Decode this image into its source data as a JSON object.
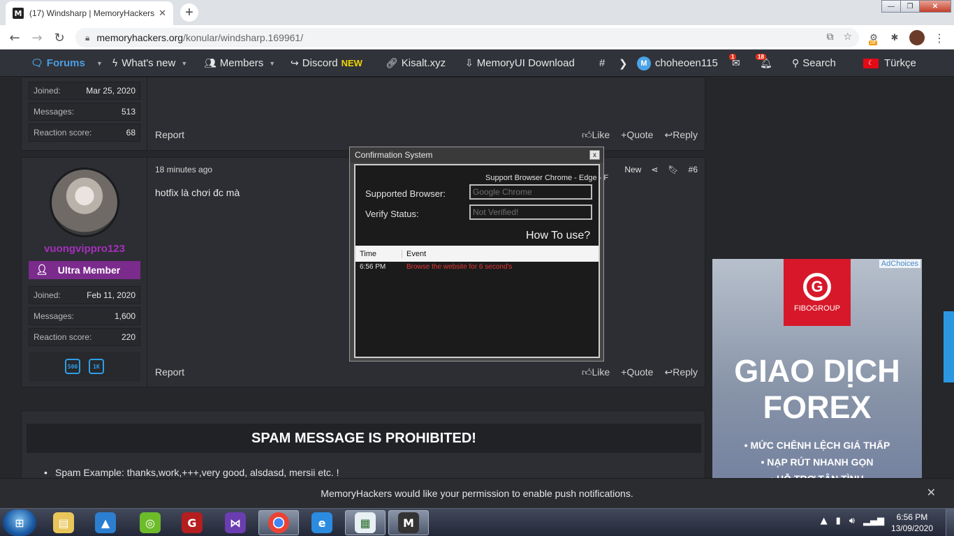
{
  "browser": {
    "tab_title": "(17) Windsharp | MemoryHackers",
    "tab_close": "✕",
    "new_tab": "+",
    "favicon": "M",
    "url_domain": "memoryhackers.org",
    "url_path": "/konular/windsharp.169961/",
    "ext_off": "off",
    "win_controls": {
      "minimize": "—",
      "maximize": "❐",
      "close": "✕"
    }
  },
  "nav": {
    "forums": "Forums",
    "whats_new": "What's new",
    "members": "Members",
    "discord": "Discord",
    "discord_badge": "NEW",
    "kisalt": "Kisalt.xyz",
    "memoryui": "MemoryUI Download",
    "hash": "#",
    "more": "❯",
    "username": "choheoen115",
    "inbox_count": "1",
    "alerts_count": "18",
    "search": "Search",
    "language": "Türkçe"
  },
  "post_top": {
    "stats": [
      {
        "key": "Joined:",
        "value": "Mar 25, 2020"
      },
      {
        "key": "Messages:",
        "value": "513"
      },
      {
        "key": "Reaction score:",
        "value": "68"
      }
    ],
    "report": "Report",
    "like": "Like",
    "quote": "+Quote",
    "reply": "Reply"
  },
  "post_main": {
    "time": "18 minutes ago",
    "new_label": "New",
    "post_number": "#6",
    "message": "hotfix là chơi đc mà",
    "username": "vuongvippro123",
    "user_title": "Ultra Member",
    "stats": [
      {
        "key": "Joined:",
        "value": "Feb 11, 2020"
      },
      {
        "key": "Messages:",
        "value": "1,600"
      },
      {
        "key": "Reaction score:",
        "value": "220"
      }
    ],
    "trophies": [
      "500",
      "1K"
    ],
    "report": "Report",
    "like": "Like",
    "quote": "+Quote",
    "reply": "Reply"
  },
  "rules": {
    "title": "SPAM MESSAGE IS PROHIBITED!",
    "item": "Spam Example: thanks,work,+++,very good, alsdasd, mersii etc. !"
  },
  "ad": {
    "adchoices": "AdChoices",
    "brand": "FIBOGROUP",
    "logo_letter": "G",
    "headline_1": "GIAO DỊCH",
    "headline_2": "FOREX",
    "bullet_1": "• MỨC CHÊNH LỆCH GIÁ THẤP",
    "bullet_2": "• NẠP RÚT NHANH GỌN",
    "bullet_3": "• HỖ TRỢ TẬN TÌNH"
  },
  "notification": {
    "message": "MemoryHackers would like your permission to enable push notifications.",
    "close": "✕"
  },
  "dialog": {
    "title": "Confirmation System",
    "close": "x",
    "subtitle": "Support Browser Chrome - Edge - F",
    "supported_label": "Supported Browser:",
    "supported_value": "Google Chrome",
    "verify_label": "Verify Status:",
    "verify_value": "Not Verified!",
    "how_to": "How To use?",
    "col_time": "Time",
    "col_event": "Event",
    "log": [
      {
        "time": "6:56 PM",
        "event": "Browse the website for 6 second's"
      }
    ],
    "event_color": "#e23636"
  },
  "taskbar": {
    "time": "6:56 PM",
    "date": "13/09/2020"
  },
  "colors": {
    "accent": "#4a9fe0",
    "discord_new": "#f0d500",
    "username": "#a62fbd",
    "user_title_bg": "#7a2b8c",
    "fibo_red": "#d7182a"
  }
}
